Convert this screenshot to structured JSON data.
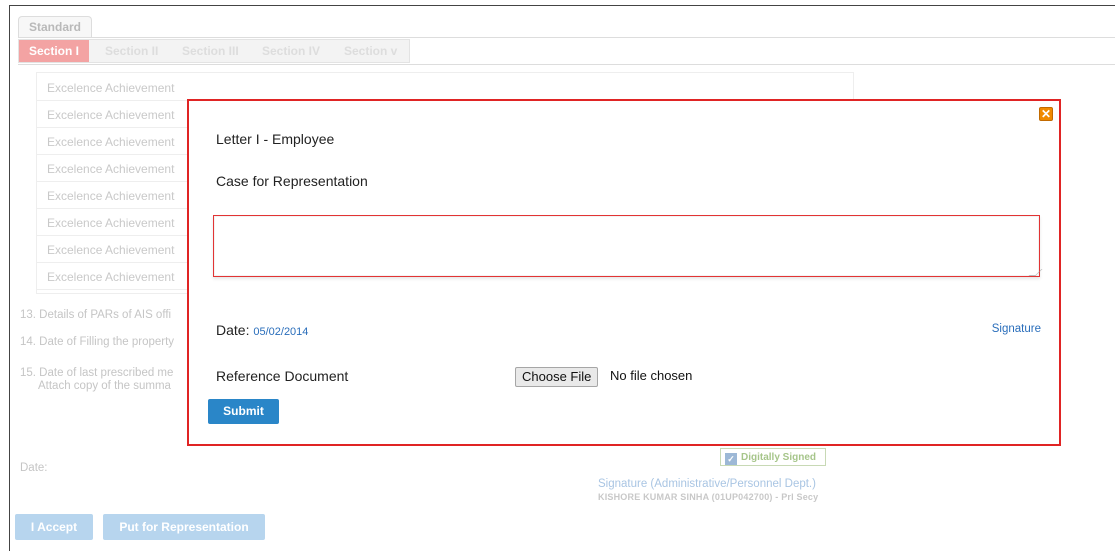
{
  "tabs": {
    "standard_label": "Standard"
  },
  "sections": [
    {
      "label": "Section I",
      "active": true
    },
    {
      "label": "Section II",
      "active": false
    },
    {
      "label": "Section III",
      "active": false
    },
    {
      "label": "Section IV",
      "active": false
    },
    {
      "label": "Section v",
      "active": false
    }
  ],
  "achievements": [
    "Excelence Achievement",
    "Excelence Achievement",
    "Excelence Achievement",
    "Excelence Achievement",
    "Excelence Achievement",
    "Excelence Achievement",
    "Excelence Achievement",
    "Excelence Achievement"
  ],
  "background": {
    "item13": "13. Details of PARs of AIS offi",
    "item14": "14. Date of Filling the property",
    "item15_line1": "15. Date of last prescribed me",
    "item15_line2": "Attach copy of the summa",
    "date_label": "Date:",
    "digitally_signed": "Digitally Signed",
    "signature_admin": "Signature (Administrative/Personnel Dept.)",
    "signer": "KISHORE KUMAR SINHA (01UP042700)  -  Prl Secy"
  },
  "footer": {
    "accept_label": "I Accept",
    "representation_label": "Put for Representation"
  },
  "modal": {
    "title": "Letter I - Employee",
    "case_label": "Case for Representation",
    "textarea_value": "",
    "date_label": "Date:",
    "date_value": "05/02/2014",
    "signature_link": "Signature",
    "reference_label": "Reference Document",
    "choose_file_label": "Choose File",
    "file_status": "No file chosen",
    "submit_label": "Submit",
    "close_symbol": "✕"
  },
  "colors": {
    "modal_border": "#e02424",
    "close_button": "#f08a00",
    "submit_button": "#2a86c8",
    "link": "#2a6ebb",
    "active_section": "#f3a3a3"
  }
}
